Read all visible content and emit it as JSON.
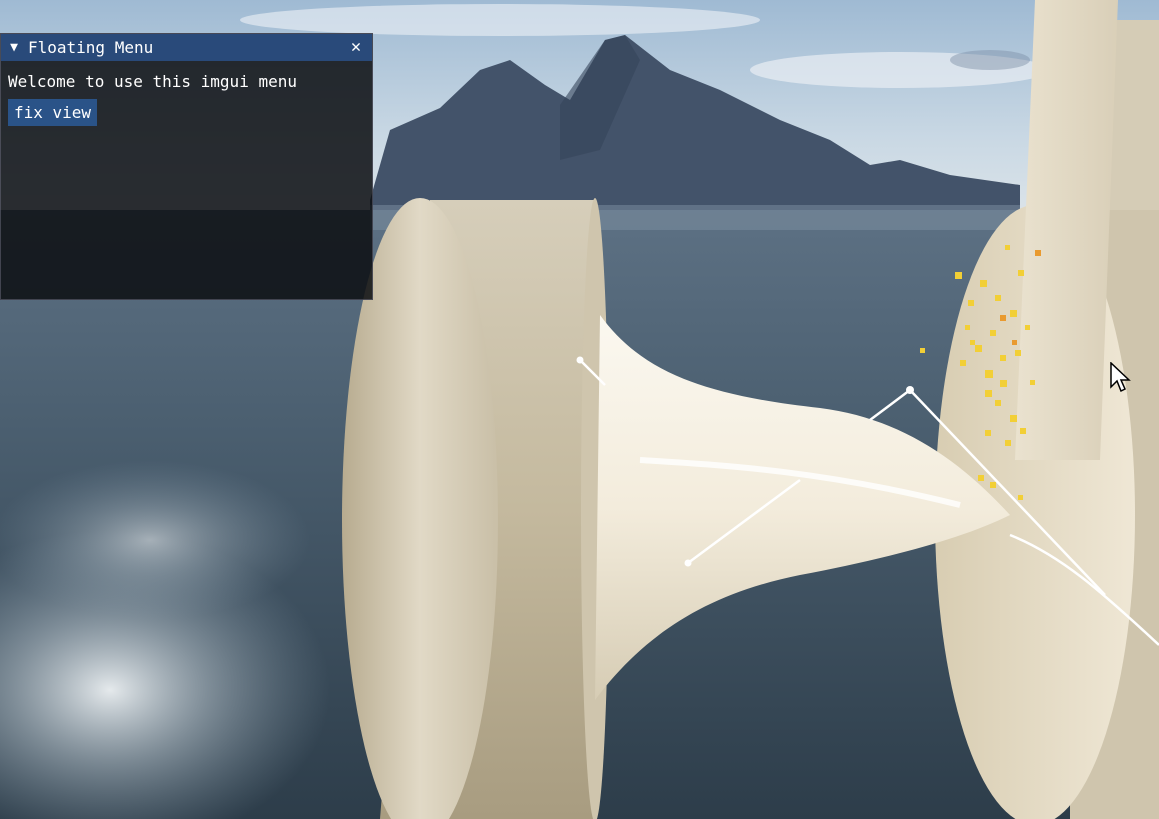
{
  "window": {
    "title": "Floating Menu",
    "collapse_icon": "triangle-down-icon",
    "close_icon": "close-icon",
    "close_glyph": "✕",
    "collapse_glyph": "▼",
    "welcome_text": "Welcome to use this imgui menu",
    "fix_view_label": "fix view"
  },
  "scene": {
    "sky_color": "#b7cbdc",
    "water_color": "#3f5566",
    "object_color": "#e8e0cd",
    "particle_color": "#f5d13a"
  },
  "cursor": {
    "icon": "mouse-pointer-icon"
  }
}
